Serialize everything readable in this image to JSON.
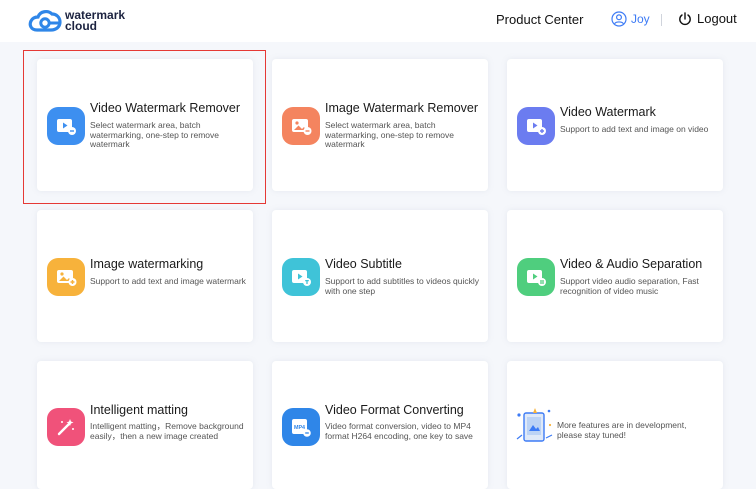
{
  "header": {
    "logo_line1": "watermark",
    "logo_line2": "cloud",
    "product_center": "Product Center",
    "user_name": "Joy",
    "logout": "Logout"
  },
  "cards": [
    {
      "title": "Video Watermark Remover",
      "desc": "Select watermark area, batch watermarking, one-step to remove watermark",
      "icon": "video-remove-icon",
      "color": "#3d8ff0"
    },
    {
      "title": "Image Watermark Remover",
      "desc": "Select watermark area, batch watermarking, one-step to remove watermark",
      "icon": "image-remove-icon",
      "color": "#f4845f"
    },
    {
      "title": "Video Watermark",
      "desc": "Support to add text and image on video",
      "icon": "video-watermark-icon",
      "color": "#6b7cf0"
    },
    {
      "title": "Image watermarking",
      "desc": "Support to add text and image watermark",
      "icon": "image-watermark-icon",
      "color": "#f7b23b"
    },
    {
      "title": "Video Subtitle",
      "desc": "Support to add subtitles to videos quickly with one step",
      "icon": "video-subtitle-icon",
      "color": "#3fc3d8"
    },
    {
      "title": "Video & Audio Separation",
      "desc": "Support video audio separation, Fast recognition of video music",
      "icon": "audio-separation-icon",
      "color": "#4fce7e"
    },
    {
      "title": "Intelligent matting",
      "desc": "Intelligent matting，Remove background easily，then a new image created",
      "icon": "magic-wand-icon",
      "color": "#f0527a"
    },
    {
      "title": "Video Format Converting",
      "desc": "Video format conversion, video to MP4 format H264 encoding, one key to save",
      "icon": "mp4-format-icon",
      "color": "#2f86e8"
    }
  ],
  "more": {
    "text": "More features are in development, please stay tuned!",
    "icon": "phone-construction-icon"
  },
  "mp4_label": "MP4"
}
